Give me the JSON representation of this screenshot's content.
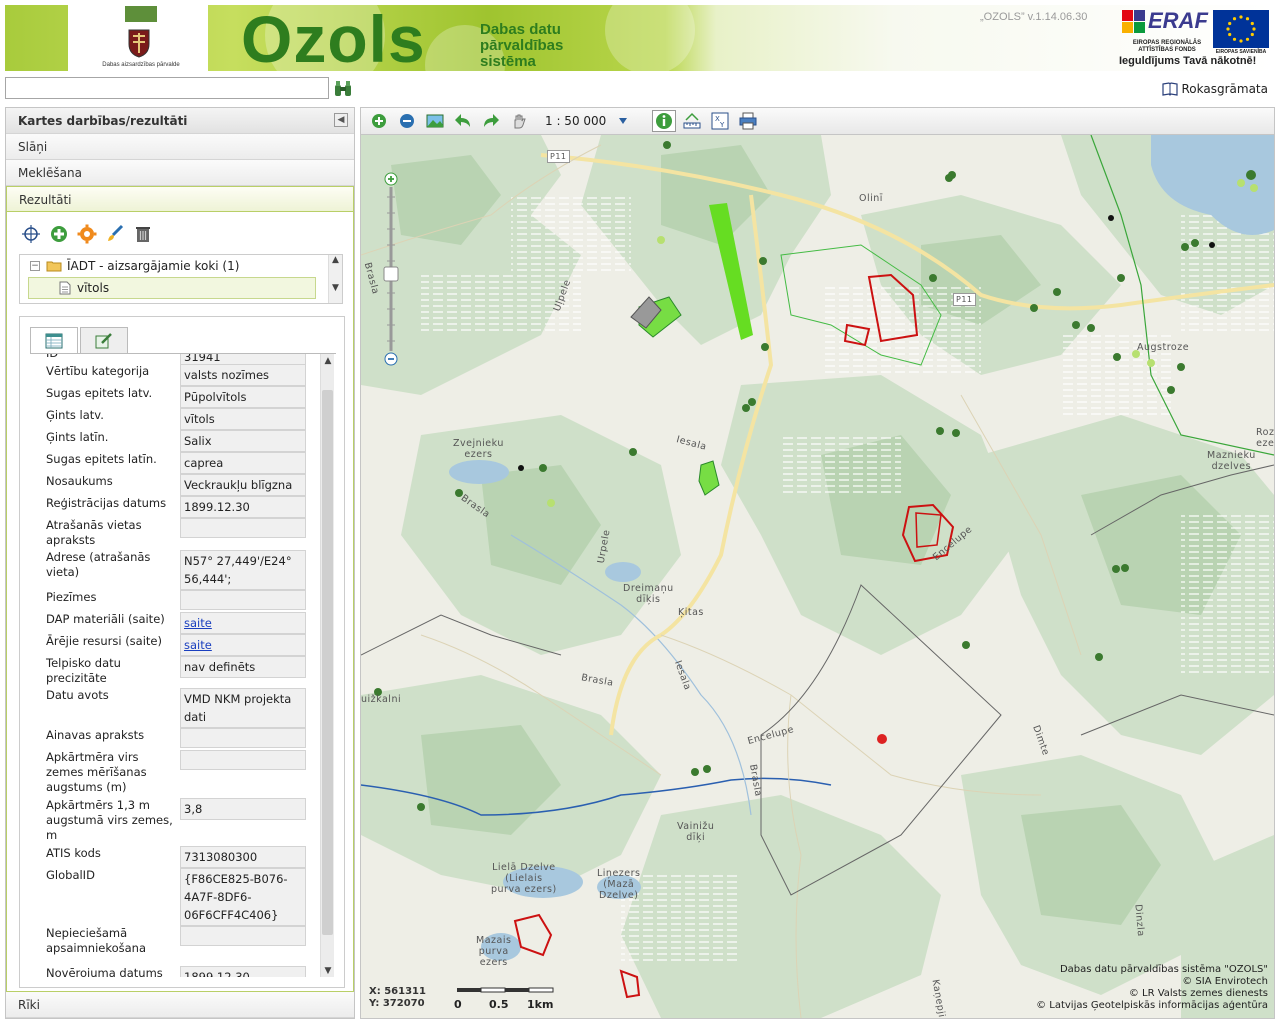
{
  "header": {
    "emblem_caption": "Dabas aizsardzības pārvalde",
    "title": "Ozols",
    "subtitle_lines": [
      "Dabas datu",
      "pārvaldības",
      "sistēma"
    ],
    "version": "„OZOLS” v.1.14.06.30",
    "eraf_logo": "ERAF",
    "eraf_sub": "EIROPAS REĢIONĀLĀS ATTĪSTĪBAS FONDS",
    "eu_sub": "EIROPAS SAVIENĪBA",
    "slogan": "Ieguldījums Tavā nākotnē!"
  },
  "search": {
    "value": "",
    "button_icon": "binoculars-icon"
  },
  "manual": {
    "label": "Rokasgrāmata",
    "icon": "book-icon"
  },
  "left_panel": {
    "main_header": "Kartes darbības/rezultāti",
    "sections": [
      "Slāņi",
      "Meklēšana",
      "Rezultāti"
    ],
    "active_section": "Rezultāti",
    "bottom_section": "Rīki",
    "result_tools": [
      "crosshair-icon",
      "zoom-plus-icon",
      "settings-icon",
      "brush-icon",
      "trash-icon"
    ],
    "tree": {
      "group": "ĪADT - aizsargājamie koki (1)",
      "item": "vītols"
    },
    "tabs": [
      "table-icon",
      "edit-icon"
    ],
    "attributes": [
      {
        "label": "ID",
        "value": "31941"
      },
      {
        "label": "Vērtību kategorija",
        "value": "valsts nozīmes"
      },
      {
        "label": "Sugas epitets latv.",
        "value": "Pūpolvītols"
      },
      {
        "label": "Ģints latv.",
        "value": "vītols"
      },
      {
        "label": "Ģints latīn.",
        "value": "Salix"
      },
      {
        "label": "Sugas epitets latīn.",
        "value": "caprea"
      },
      {
        "label": "Nosaukums",
        "value": "Veckraukļu blīgzna"
      },
      {
        "label": "Reģistrācijas datums",
        "value": "1899.12.30"
      },
      {
        "label": "Atrašanās vietas apraksts",
        "value": ""
      },
      {
        "label": "Adrese (atrašanās vieta)",
        "value": "N57° 27,449'/E24° 56,444';"
      },
      {
        "label": "Piezīmes",
        "value": ""
      },
      {
        "label": "DAP materiāli (saite)",
        "value": "saite",
        "link": true
      },
      {
        "label": "Ārējie resursi (saite)",
        "value": "saite",
        "link": true
      },
      {
        "label": "Telpisko datu precizitāte",
        "value": "nav definēts"
      },
      {
        "label": "Datu avots",
        "value": "VMD NKM projekta dati"
      },
      {
        "label": "Ainavas apraksts",
        "value": ""
      },
      {
        "label": "Apkārtmēra virs zemes mērīšanas augstums (m)",
        "value": ""
      },
      {
        "label": "Apkārtmērs 1,3 m augstumā virs zemes, m",
        "value": "3,8"
      },
      {
        "label": "ATIS kods",
        "value": "7313080300"
      },
      {
        "label": "GlobalID",
        "value": "{F86CE825-B076-4A7F-8DF6-06F6CFF4C406}"
      },
      {
        "label": "Nepieciešamā apsaimniekošana",
        "value": ""
      },
      {
        "label": "Novērojuma datums",
        "value": "1899.12.30"
      }
    ]
  },
  "map": {
    "toolbar_icons": [
      "zoom-in-icon",
      "zoom-out-icon",
      "full-extent-icon",
      "back-icon",
      "forward-icon",
      "pan-hand-icon"
    ],
    "scale": "1 : 50 000",
    "toolbar_icons_right": [
      "info-icon",
      "measure-icon",
      "coordinate-icon",
      "print-icon"
    ],
    "labels": {
      "p11_a": "P11",
      "olini": "Olinī",
      "p11_b": "P11",
      "augstroze": "Augstroze",
      "brasla_a": "Brasla",
      "ulpele": "Uļpele",
      "zvejnieku": "Zvejnieku\nezers",
      "iesala_a": "Iesala",
      "brasla_b": "Brasla",
      "urpele": "Urpele",
      "dreimanu": "Dreimaņu\ndīķis",
      "kitas": "Ķitas",
      "encelupe_a": "Encelupe",
      "brasla_c": "Brasla",
      "iesala_b": "Iesala",
      "muizkalni": "uižkalni",
      "encelupe_b": "Encelupe",
      "brasla_d": "Brasla",
      "vainizu": "Vainižu\ndīķi",
      "liela_dzelve": "Lielā Dzelve\n(Lielais\npurva ezers)",
      "linezers": "Liņezers\n(Mazā\nDzelve)",
      "mazais": "Mazais\npurva\nezers",
      "roz": "Roz\neze",
      "maznieku": "Maznieku\ndzelves",
      "dimtene": "Dimte",
      "dinzla": "Dinzla",
      "kanepji": "Kaņepji"
    },
    "coords": {
      "x": "X: 561311",
      "y": "Y: 372070"
    },
    "scalebar": [
      "0",
      "0.5",
      "1km"
    ],
    "attribution": [
      "Dabas datu pārvaldības sistēma \"OZOLS\"",
      "© SIA Envirotech",
      "© LR Valsts zemes dienests",
      "© Latvijas Ģeotelpiskās informācijas aģentūra"
    ]
  }
}
